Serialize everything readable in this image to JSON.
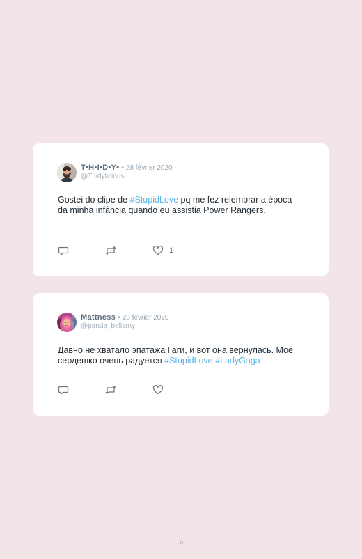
{
  "tweets": [
    {
      "display_name": "T•H•I•D•Y•",
      "separator": "•",
      "date": "28 février 2020",
      "handle": "@Thidylicious",
      "text_parts": [
        "Gostei do clipe de ",
        "#StupidLove",
        " pq me fez relembrar a época da minha infância quando eu assistia Power Rangers."
      ],
      "likes": "1",
      "avatar_icon": "user-avatar-bearded-man"
    },
    {
      "display_name": "Mattness",
      "separator": "•",
      "date": "28 février 2020",
      "handle": "@panda_bellamy",
      "text_parts": [
        "Давно не хватало эпатажа Гаги, и вот она вернулась. Мое сердешко очень радуется ",
        "#StupidLove",
        " ",
        "#LadyGaga"
      ],
      "likes": "",
      "avatar_icon": "user-avatar-pink-hair"
    }
  ],
  "page_number": "32",
  "colors": {
    "background": "#f3e4e7",
    "card": "#ffffff",
    "hashtag": "#5bb6e8",
    "icon": "#6b7781"
  }
}
